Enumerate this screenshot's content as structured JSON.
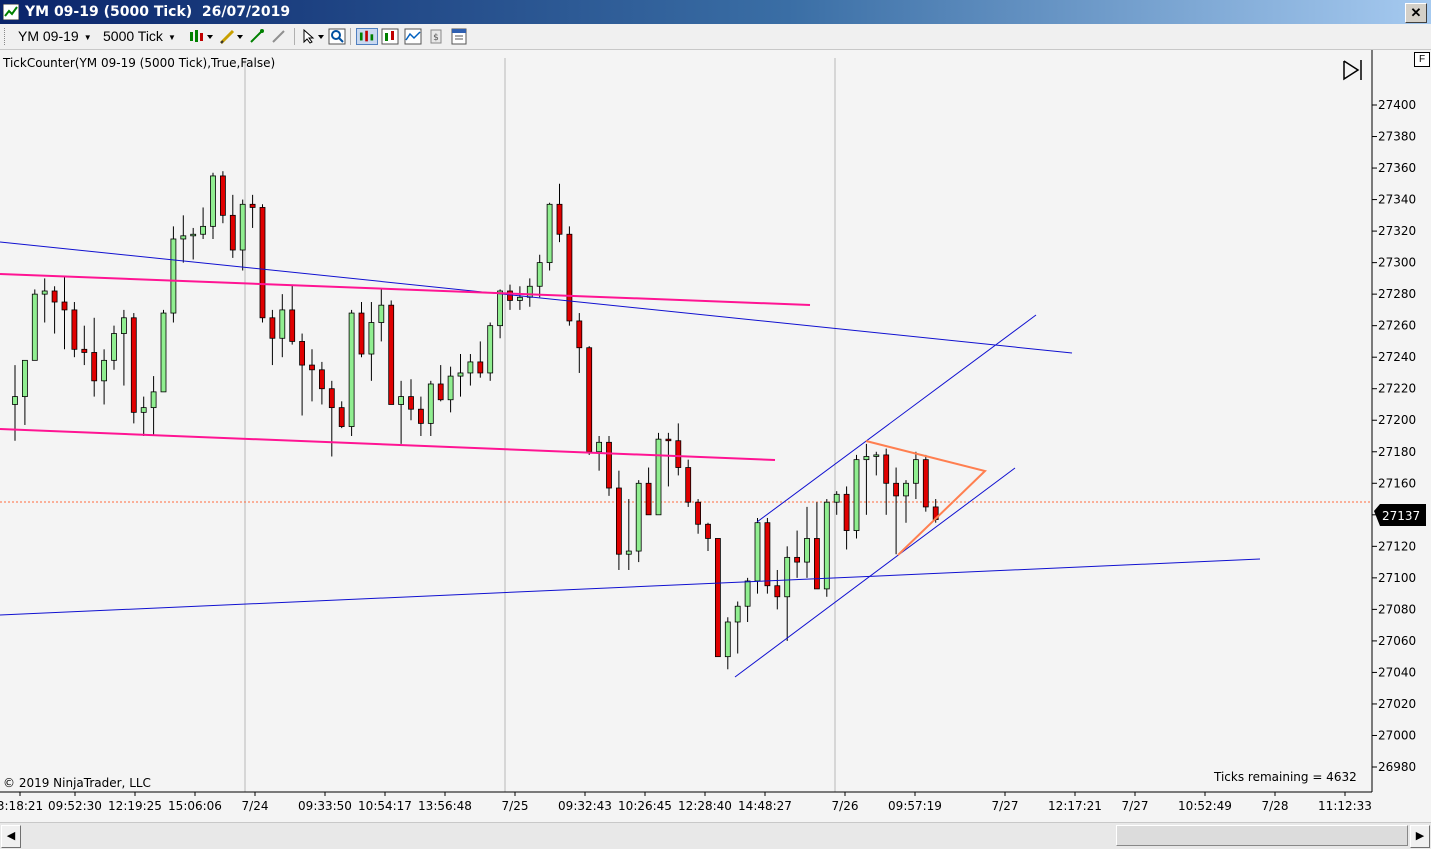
{
  "window": {
    "title": "YM 09-19 (5000 Tick)  26/07/2019",
    "close_label": "✕"
  },
  "toolbar": {
    "instrument": "YM 09-19",
    "period": "5000 Tick",
    "icons": [
      "bar-style-icon",
      "draw-pencil-icon",
      "crosshair-icon",
      "zoom-icon",
      "select-pointer-icon",
      "magnify-icon",
      "chart-style-icon",
      "price-markers-icon",
      "indicators-icon",
      "strategies-icon",
      "properties-icon"
    ]
  },
  "chart": {
    "indicator_label": "TickCounter(YM  09-19 (5000  Tick),True,False)",
    "copyright": "© 2019 NinjaTrader, LLC",
    "ticks_remaining": "Ticks remaining = 4632",
    "current_price": "27137",
    "panel_button": "F",
    "colors": {
      "up_body": "#90ee90",
      "down_body": "#e00000",
      "wick": "#000000",
      "trend_blue": "#1010d0",
      "channel_pink": "#ff1493",
      "triangle": "#ff7f50",
      "price_line": "#ff6a3d",
      "background": "#f4f4f4"
    },
    "y_ticks": [
      "27400",
      "27380",
      "27360",
      "27340",
      "27320",
      "27300",
      "27280",
      "27260",
      "27240",
      "27220",
      "27200",
      "27180",
      "27160",
      "27140",
      "27120",
      "27100",
      "27080",
      "27060",
      "27040",
      "27020",
      "27000",
      "26980"
    ],
    "x_labels": [
      "3:18:21",
      "09:52:30",
      "12:19:25",
      "15:06:06",
      "7/24",
      "09:33:50",
      "10:54:17",
      "13:56:48",
      "7/25",
      "09:32:43",
      "10:26:45",
      "12:28:40",
      "14:48:27",
      "7/26",
      "09:57:19",
      "7/27",
      "12:17:21",
      "7/27",
      "10:52:49",
      "7/28",
      "11:12:33"
    ]
  },
  "chart_data": {
    "type": "candlestick",
    "y_range": [
      26970,
      27420
    ],
    "candles": [
      {
        "o": 27210,
        "h": 27235,
        "l": 27187,
        "c": 27215
      },
      {
        "o": 27215,
        "h": 27232,
        "l": 27197,
        "c": 27238
      },
      {
        "o": 27238,
        "h": 27283,
        "l": 27238,
        "c": 27280
      },
      {
        "o": 27280,
        "h": 27290,
        "l": 27262,
        "c": 27282
      },
      {
        "o": 27282,
        "h": 27285,
        "l": 27255,
        "c": 27275
      },
      {
        "o": 27275,
        "h": 27291,
        "l": 27245,
        "c": 27270
      },
      {
        "o": 27270,
        "h": 27275,
        "l": 27240,
        "c": 27245
      },
      {
        "o": 27245,
        "h": 27260,
        "l": 27235,
        "c": 27243
      },
      {
        "o": 27243,
        "h": 27265,
        "l": 27215,
        "c": 27225
      },
      {
        "o": 27225,
        "h": 27245,
        "l": 27210,
        "c": 27238
      },
      {
        "o": 27238,
        "h": 27260,
        "l": 27232,
        "c": 27255
      },
      {
        "o": 27255,
        "h": 27270,
        "l": 27222,
        "c": 27265
      },
      {
        "o": 27265,
        "h": 27268,
        "l": 27198,
        "c": 27205
      },
      {
        "o": 27205,
        "h": 27215,
        "l": 27190,
        "c": 27208
      },
      {
        "o": 27208,
        "h": 27228,
        "l": 27190,
        "c": 27218
      },
      {
        "o": 27218,
        "h": 27270,
        "l": 27218,
        "c": 27268
      },
      {
        "o": 27268,
        "h": 27323,
        "l": 27262,
        "c": 27315
      },
      {
        "o": 27315,
        "h": 27330,
        "l": 27300,
        "c": 27317
      },
      {
        "o": 27317,
        "h": 27322,
        "l": 27302,
        "c": 27318
      },
      {
        "o": 27318,
        "h": 27335,
        "l": 27315,
        "c": 27323
      },
      {
        "o": 27323,
        "h": 27357,
        "l": 27315,
        "c": 27355
      },
      {
        "o": 27355,
        "h": 27358,
        "l": 27325,
        "c": 27330
      },
      {
        "o": 27330,
        "h": 27343,
        "l": 27303,
        "c": 27308
      },
      {
        "o": 27308,
        "h": 27340,
        "l": 27295,
        "c": 27337
      },
      {
        "o": 27337,
        "h": 27343,
        "l": 27322,
        "c": 27335
      },
      {
        "o": 27335,
        "h": 27337,
        "l": 27262,
        "c": 27265
      },
      {
        "o": 27265,
        "h": 27270,
        "l": 27235,
        "c": 27252
      },
      {
        "o": 27252,
        "h": 27280,
        "l": 27240,
        "c": 27270
      },
      {
        "o": 27270,
        "h": 27286,
        "l": 27248,
        "c": 27250
      },
      {
        "o": 27250,
        "h": 27255,
        "l": 27203,
        "c": 27235
      },
      {
        "o": 27235,
        "h": 27245,
        "l": 27212,
        "c": 27232
      },
      {
        "o": 27232,
        "h": 27237,
        "l": 27210,
        "c": 27220
      },
      {
        "o": 27220,
        "h": 27225,
        "l": 27177,
        "c": 27208
      },
      {
        "o": 27208,
        "h": 27212,
        "l": 27195,
        "c": 27196
      },
      {
        "o": 27196,
        "h": 27270,
        "l": 27190,
        "c": 27268
      },
      {
        "o": 27268,
        "h": 27275,
        "l": 27240,
        "c": 27242
      },
      {
        "o": 27242,
        "h": 27275,
        "l": 27225,
        "c": 27262
      },
      {
        "o": 27262,
        "h": 27283,
        "l": 27250,
        "c": 27273
      },
      {
        "o": 27273,
        "h": 27276,
        "l": 27210,
        "c": 27210
      },
      {
        "o": 27210,
        "h": 27225,
        "l": 27185,
        "c": 27215
      },
      {
        "o": 27215,
        "h": 27226,
        "l": 27200,
        "c": 27207
      },
      {
        "o": 27207,
        "h": 27215,
        "l": 27190,
        "c": 27198
      },
      {
        "o": 27198,
        "h": 27225,
        "l": 27190,
        "c": 27223
      },
      {
        "o": 27223,
        "h": 27235,
        "l": 27212,
        "c": 27213
      },
      {
        "o": 27213,
        "h": 27234,
        "l": 27205,
        "c": 27228
      },
      {
        "o": 27228,
        "h": 27242,
        "l": 27215,
        "c": 27230
      },
      {
        "o": 27230,
        "h": 27242,
        "l": 27222,
        "c": 27237
      },
      {
        "o": 27237,
        "h": 27250,
        "l": 27227,
        "c": 27230
      },
      {
        "o": 27230,
        "h": 27262,
        "l": 27225,
        "c": 27260
      },
      {
        "o": 27260,
        "h": 27283,
        "l": 27252,
        "c": 27282
      },
      {
        "o": 27282,
        "h": 27286,
        "l": 27270,
        "c": 27276
      },
      {
        "o": 27276,
        "h": 27285,
        "l": 27270,
        "c": 27278
      },
      {
        "o": 27278,
        "h": 27290,
        "l": 27272,
        "c": 27285
      },
      {
        "o": 27285,
        "h": 27305,
        "l": 27278,
        "c": 27300
      },
      {
        "o": 27300,
        "h": 27338,
        "l": 27295,
        "c": 27337
      },
      {
        "o": 27337,
        "h": 27350,
        "l": 27313,
        "c": 27318
      },
      {
        "o": 27318,
        "h": 27323,
        "l": 27260,
        "c": 27263
      },
      {
        "o": 27263,
        "h": 27268,
        "l": 27230,
        "c": 27246
      },
      {
        "o": 27246,
        "h": 27247,
        "l": 27178,
        "c": 27180
      },
      {
        "o": 27180,
        "h": 27190,
        "l": 27168,
        "c": 27186
      },
      {
        "o": 27186,
        "h": 27190,
        "l": 27152,
        "c": 27157
      },
      {
        "o": 27157,
        "h": 27168,
        "l": 27105,
        "c": 27115
      },
      {
        "o": 27115,
        "h": 27150,
        "l": 27105,
        "c": 27117
      },
      {
        "o": 27117,
        "h": 27162,
        "l": 27110,
        "c": 27160
      },
      {
        "o": 27160,
        "h": 27170,
        "l": 27140,
        "c": 27140
      },
      {
        "o": 27140,
        "h": 27192,
        "l": 27140,
        "c": 27188
      },
      {
        "o": 27188,
        "h": 27192,
        "l": 27158,
        "c": 27187
      },
      {
        "o": 27187,
        "h": 27198,
        "l": 27165,
        "c": 27170
      },
      {
        "o": 27170,
        "h": 27175,
        "l": 27145,
        "c": 27148
      },
      {
        "o": 27148,
        "h": 27150,
        "l": 27128,
        "c": 27134
      },
      {
        "o": 27134,
        "h": 27135,
        "l": 27117,
        "c": 27125
      },
      {
        "o": 27125,
        "h": 27125,
        "l": 27050,
        "c": 27050
      },
      {
        "o": 27050,
        "h": 27075,
        "l": 27042,
        "c": 27072
      },
      {
        "o": 27072,
        "h": 27085,
        "l": 27052,
        "c": 27082
      },
      {
        "o": 27082,
        "h": 27100,
        "l": 27072,
        "c": 27098
      },
      {
        "o": 27098,
        "h": 27138,
        "l": 27090,
        "c": 27135
      },
      {
        "o": 27135,
        "h": 27138,
        "l": 27090,
        "c": 27095
      },
      {
        "o": 27095,
        "h": 27105,
        "l": 27080,
        "c": 27088
      },
      {
        "o": 27088,
        "h": 27120,
        "l": 27060,
        "c": 27113
      },
      {
        "o": 27113,
        "h": 27130,
        "l": 27100,
        "c": 27110
      },
      {
        "o": 27110,
        "h": 27145,
        "l": 27100,
        "c": 27125
      },
      {
        "o": 27125,
        "h": 27148,
        "l": 27093,
        "c": 27093
      },
      {
        "o": 27093,
        "h": 27150,
        "l": 27088,
        "c": 27148
      },
      {
        "o": 27148,
        "h": 27155,
        "l": 27140,
        "c": 27153
      },
      {
        "o": 27153,
        "h": 27158,
        "l": 27118,
        "c": 27130
      },
      {
        "o": 27130,
        "h": 27178,
        "l": 27125,
        "c": 27175
      },
      {
        "o": 27175,
        "h": 27185,
        "l": 27140,
        "c": 27177
      },
      {
        "o": 27177,
        "h": 27180,
        "l": 27165,
        "c": 27178
      },
      {
        "o": 27178,
        "h": 27182,
        "l": 27140,
        "c": 27160
      },
      {
        "o": 27160,
        "h": 27170,
        "l": 27115,
        "c": 27152
      },
      {
        "o": 27152,
        "h": 27162,
        "l": 27135,
        "c": 27160
      },
      {
        "o": 27160,
        "h": 27180,
        "l": 27150,
        "c": 27175
      },
      {
        "o": 27175,
        "h": 27178,
        "l": 27142,
        "c": 27145
      },
      {
        "o": 27145,
        "h": 27150,
        "l": 27135,
        "c": 27137
      }
    ]
  }
}
